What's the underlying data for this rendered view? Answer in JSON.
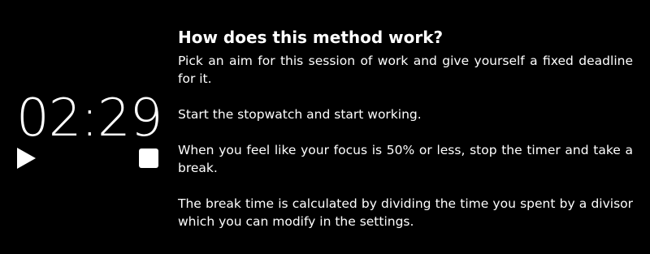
{
  "timer": {
    "display": "02:29",
    "play_icon": "play-icon",
    "stop_icon": "stop-icon"
  },
  "info": {
    "title": "How does this method work?",
    "paragraphs": [
      "Pick an aim for this session of work and give yourself a fixed deadline for it.",
      "Start the stopwatch and start working.",
      "When you feel like your focus is 50% or less, stop the timer and take a break.",
      "The break time is calculated by dividing the time you spent by a divisor which you can modify in the settings."
    ]
  },
  "colors": {
    "background": "#000000",
    "foreground": "#ffffff"
  }
}
